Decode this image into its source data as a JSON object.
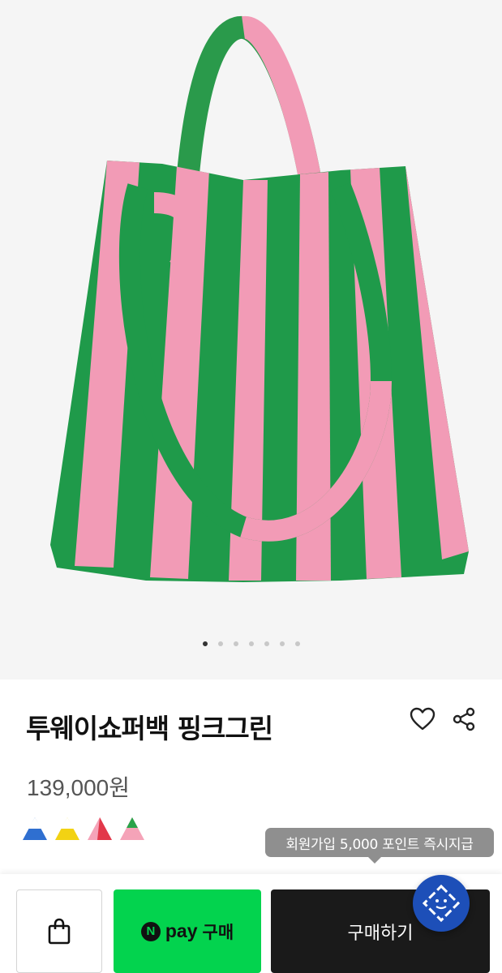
{
  "product": {
    "name": "투웨이쇼퍼백 핑크그린",
    "price": "139,000원",
    "image_colors": {
      "pink": "#f29bb6",
      "green": "#1f9a4a"
    },
    "gallery": {
      "image_count": 7,
      "active_index": 1
    }
  },
  "color_options": [
    {
      "name": "blue",
      "accent": "#2f6fd0"
    },
    {
      "name": "yellow",
      "accent": "#f2d213"
    },
    {
      "name": "red",
      "accent": "#e2384a"
    },
    {
      "name": "green",
      "accent": "#2aa34a"
    }
  ],
  "promo": {
    "tooltip": "회원가입 5,000 포인트 즉시지급"
  },
  "actions": {
    "cart_icon": "shopping-bag-icon",
    "npay_badge": "N",
    "npay_brand": "pay",
    "npay_buy": "구매",
    "buy_label": "구매하기",
    "wishlist_icon": "heart-icon",
    "share_icon": "share-icon",
    "chat_icon": "chat-bot-icon"
  },
  "colors": {
    "npay_green": "#03d34e",
    "buy_black": "#1a1a1a",
    "chat_blue": "#1d4fb8",
    "tooltip_gray": "#8f8f8f"
  }
}
